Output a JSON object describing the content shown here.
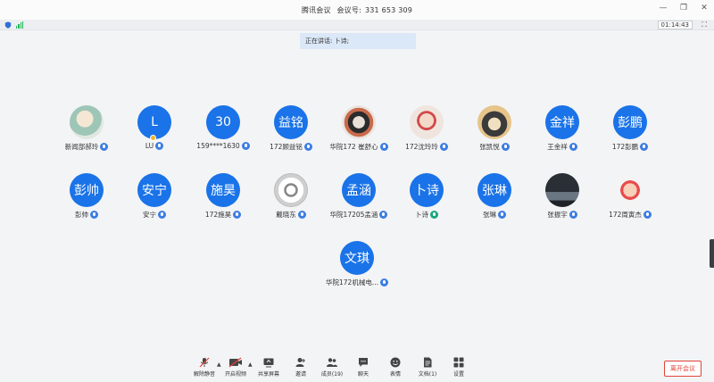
{
  "titlebar": {
    "app_name": "腾讯会议",
    "meeting_label": "会议号:",
    "meeting_id": "331 653 309"
  },
  "statusbar": {
    "timer": "01:14:43",
    "icons": [
      "shield-icon",
      "signal-icon",
      "fullscreen-icon"
    ]
  },
  "speaker_banner": {
    "label": "正在讲话:",
    "name": "卜诗;"
  },
  "participants": [
    {
      "name": "新闻部郝玲",
      "avatar_text": "",
      "avatar_type": "photo"
    },
    {
      "name": "LU",
      "avatar_text": "L",
      "avatar_type": "text",
      "host_badge": true
    },
    {
      "name": "159****1630",
      "avatar_text": "30",
      "avatar_type": "text"
    },
    {
      "name": "172顾益铭",
      "avatar_text": "益铭",
      "avatar_type": "text"
    },
    {
      "name": "华院172 崔舒心",
      "avatar_text": "",
      "avatar_type": "photo"
    },
    {
      "name": "172沈玲玲",
      "avatar_text": "",
      "avatar_type": "photo"
    },
    {
      "name": "张凯悦",
      "avatar_text": "",
      "avatar_type": "photo"
    },
    {
      "name": "王金祥",
      "avatar_text": "金祥",
      "avatar_type": "text"
    },
    {
      "name": "172彭鹏",
      "avatar_text": "彭鹏",
      "avatar_type": "text"
    },
    {
      "name": "彭帅",
      "avatar_text": "彭帅",
      "avatar_type": "text"
    },
    {
      "name": "安宁",
      "avatar_text": "安宁",
      "avatar_type": "text"
    },
    {
      "name": "172施昊",
      "avatar_text": "施昊",
      "avatar_type": "text"
    },
    {
      "name": "戴晓东",
      "avatar_text": "",
      "avatar_type": "photo"
    },
    {
      "name": "华院17205孟涵",
      "avatar_text": "孟涵",
      "avatar_type": "text"
    },
    {
      "name": "卜诗",
      "avatar_text": "卜诗",
      "avatar_type": "text",
      "speaking": true
    },
    {
      "name": "张琳",
      "avatar_text": "张琳",
      "avatar_type": "text"
    },
    {
      "name": "张振宇",
      "avatar_text": "",
      "avatar_type": "photo"
    },
    {
      "name": "172周寅杰",
      "avatar_text": "",
      "avatar_type": "photo"
    },
    {
      "name": "华院172机械电...",
      "avatar_text": "文琪",
      "avatar_type": "text"
    }
  ],
  "toolbar": {
    "unmute": "解除静音",
    "start_video": "开启视频",
    "share_screen": "共享屏幕",
    "invite": "邀请",
    "members": "成员(19)",
    "chat": "聊天",
    "reactions": "表情",
    "docs": "文档(1)",
    "settings": "设置",
    "leave": "离开会议"
  },
  "colors": {
    "avatar_blue": "#1a73e8",
    "mic_blue": "#3c7de3",
    "mic_active_green": "#1aa77c",
    "leave_red": "#e0433a",
    "banner_bg": "#dbe8f8"
  }
}
